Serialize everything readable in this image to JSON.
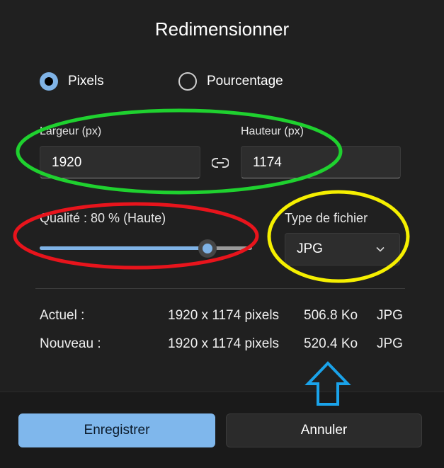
{
  "dialog": {
    "title": "Redimensionner",
    "mode": {
      "pixels_label": "Pixels",
      "percent_label": "Pourcentage",
      "selected": "Pixels"
    },
    "width": {
      "label": "Largeur  (px)",
      "value": "1920"
    },
    "height": {
      "label": "Hauteur  (px)",
      "value": "1174"
    },
    "quality": {
      "label": "Qualité : 80 % (Haute)",
      "value_percent": 80
    },
    "file_type": {
      "label": "Type de fichier",
      "value": "JPG"
    },
    "current": {
      "label": "Actuel :",
      "dimensions": "1920 x 1174 pixels",
      "size": "506.8 Ko",
      "format": "JPG"
    },
    "new": {
      "label": "Nouveau :",
      "dimensions": "1920 x 1174 pixels",
      "size": "520.4 Ko",
      "format": "JPG"
    },
    "buttons": {
      "save": "Enregistrer",
      "cancel": "Annuler"
    }
  },
  "colors": {
    "accent": "#7fb3e6",
    "annotation_green": "#1fd12f",
    "annotation_red": "#e8141c",
    "annotation_yellow": "#f5ef00",
    "annotation_blue": "#1aa3ea"
  }
}
